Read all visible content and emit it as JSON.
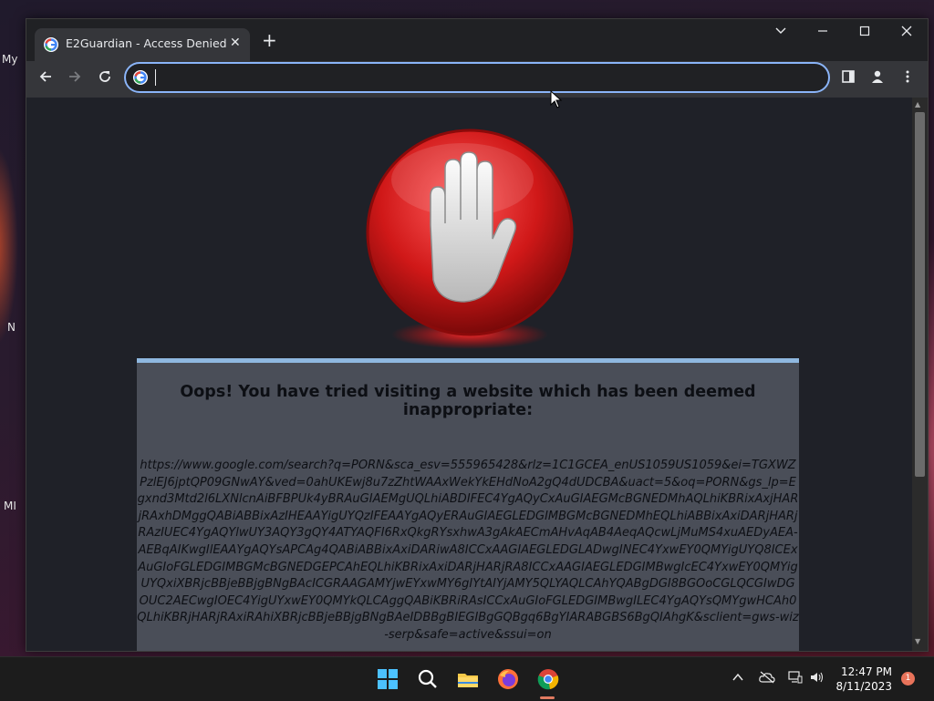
{
  "desktop": {
    "label_my": "My",
    "label_n": "N",
    "label_mi": "MI"
  },
  "browser": {
    "tab_title": "E2Guardian - Access Denied",
    "address_value": "",
    "accent_color": "#8ab4f8"
  },
  "page": {
    "heading": "Oops! You have tried visiting a website which has been deemed inappropriate:",
    "blocked_url": "https://www.google.com/search?q=PORN&sca_esv=555965428&rlz=1C1GCEA_enUS1059US1059&ei=TGXWZPzlEJ6jptQP09GNwAY&ved=0ahUKEwj8u7zZhtWAAxWekYkEHdNoA2gQ4dUDCBA&uact=5&oq=PORN&gs_lp=Egxnd3Mtd2l6LXNlcnAiBFBPUk4yBRAuGIAEMgUQLhiABDIFEC4YgAQyCxAuGIAEGMcBGNEDMhAQLhiKBRixAxjHARjRAxhDMggQABiABBixAzIHEAAYigUYQzIFEAAYgAQyERAuGIAEGLEDGIMBGMcBGNEDMhEQLhiABBixAxiDARjHARjRAzIUEC4YgAQYlwUY3AQY3gQY4ATYAQFI6RxQkgRYsxhwA3gAkAECmAHvAqAB4AeqAQcwLjMuMS4xuAEDyAEA-AEBqAIKwgIlEAAYgAQYsAPCAg4QABiABBixAxiDARiwA8ICCxAAGIAEGLEDGLADwgINEC4YxwEY0QMYigUYQ8ICExAuGIoFGLEDGIMBGMcBGNEDGEPCAhEQLhiKBRixAxiDARjHARjRA8ICCxAAGIAEGLEDGIMBwgIcEC4YxwEY0QMYigUYQxiXBRjcBBjeBBjgBNgBAcICGRAAGAMYjwEYxwMY6gIYtAIYjAMY5QLYAQLCAhYQABgDGI8BGOoCGLQCGIwDGOUC2AECwgIOEC4YigUYxwEY0QMYkQLCAggQABiKBRiRAsICCxAuGIoFGLEDGIMBwgILEC4YgAQYsQMYgwHCAh0QLhiKBRjHARjRAxiRAhiXBRjcBBjeBBjgBNgBAeIDBBgBIEGIBgGQBgq6BgYIARABGBS6BgQIAhgK&sclient=gws-wiz-serp&safe=active&ssui=on"
  },
  "taskbar": {
    "time": "12:47 PM",
    "date": "8/11/2023",
    "notification_count": "1"
  }
}
